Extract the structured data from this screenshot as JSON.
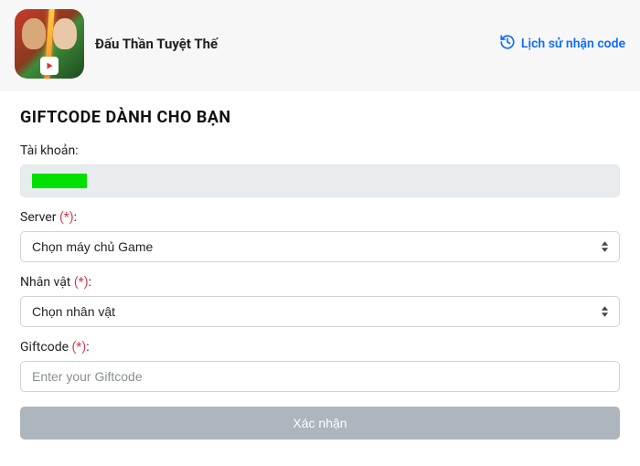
{
  "header": {
    "game_title": "Đấu Thần Tuyệt Thế",
    "history_link": "Lịch sử nhận code"
  },
  "section_title": "GIFTCODE DÀNH CHO BẠN",
  "fields": {
    "account": {
      "label": "Tài khoản:"
    },
    "server": {
      "label": "Server ",
      "required_mark": "(*)",
      "colon": ":",
      "placeholder_option": "Chọn máy chủ Game"
    },
    "character": {
      "label": "Nhân vật ",
      "required_mark": "(*)",
      "colon": ":",
      "placeholder_option": "Chọn nhân vật"
    },
    "giftcode": {
      "label": "Giftcode ",
      "required_mark": "(*)",
      "colon": ":",
      "placeholder": "Enter your Giftcode"
    }
  },
  "submit_label": "Xác nhận"
}
